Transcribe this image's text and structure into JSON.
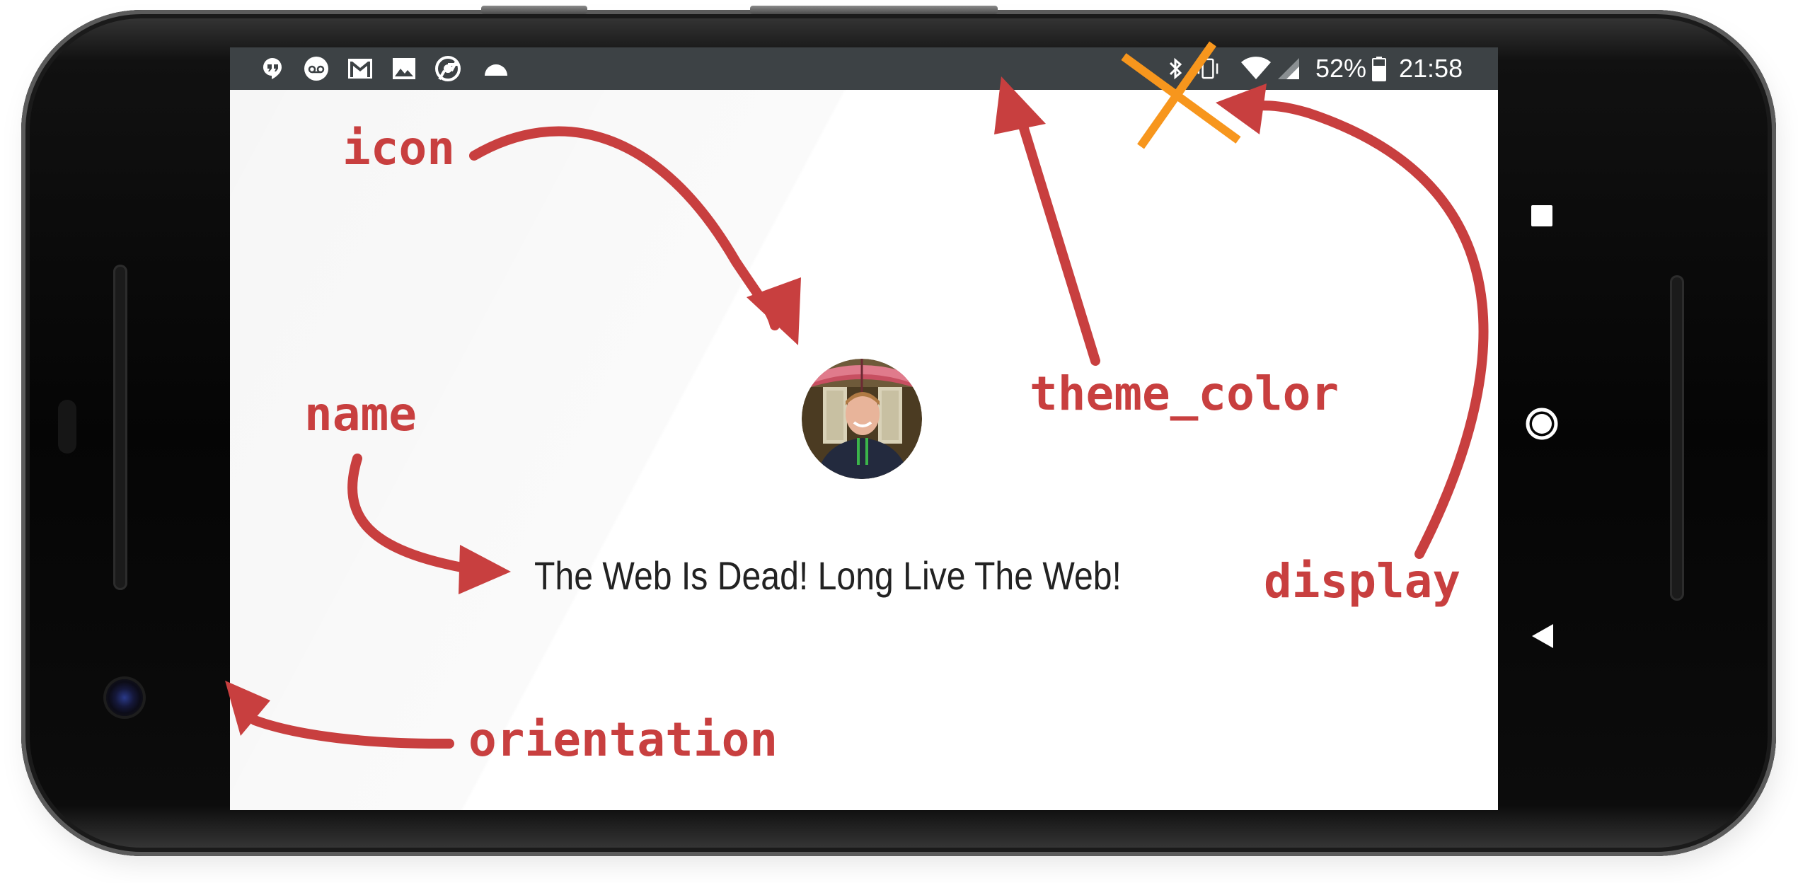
{
  "status_bar": {
    "notification_icons": [
      "hangouts-icon",
      "voicemail-icon",
      "gmail-icon",
      "gallery-icon",
      "chrome-icon",
      "dome-icon"
    ],
    "system_icons": [
      "bluetooth-icon",
      "vibrate-icon",
      "wifi-icon",
      "signal-icon",
      "battery-icon"
    ],
    "battery_percent": "52%",
    "time": "21:58",
    "background_color": "#3d4245"
  },
  "splash": {
    "app_name": "The Web Is Dead! Long Live The Web!",
    "icon": "profile-photo-icon"
  },
  "annotations": {
    "icon": "icon",
    "name": "name",
    "theme_color": "theme_color",
    "display": "display",
    "orientation": "orientation",
    "color": "#c83f3f",
    "cross_color": "#f7961d"
  },
  "nav_bar": {
    "buttons": [
      "recents-square-icon",
      "home-circle-icon",
      "back-triangle-icon"
    ]
  }
}
